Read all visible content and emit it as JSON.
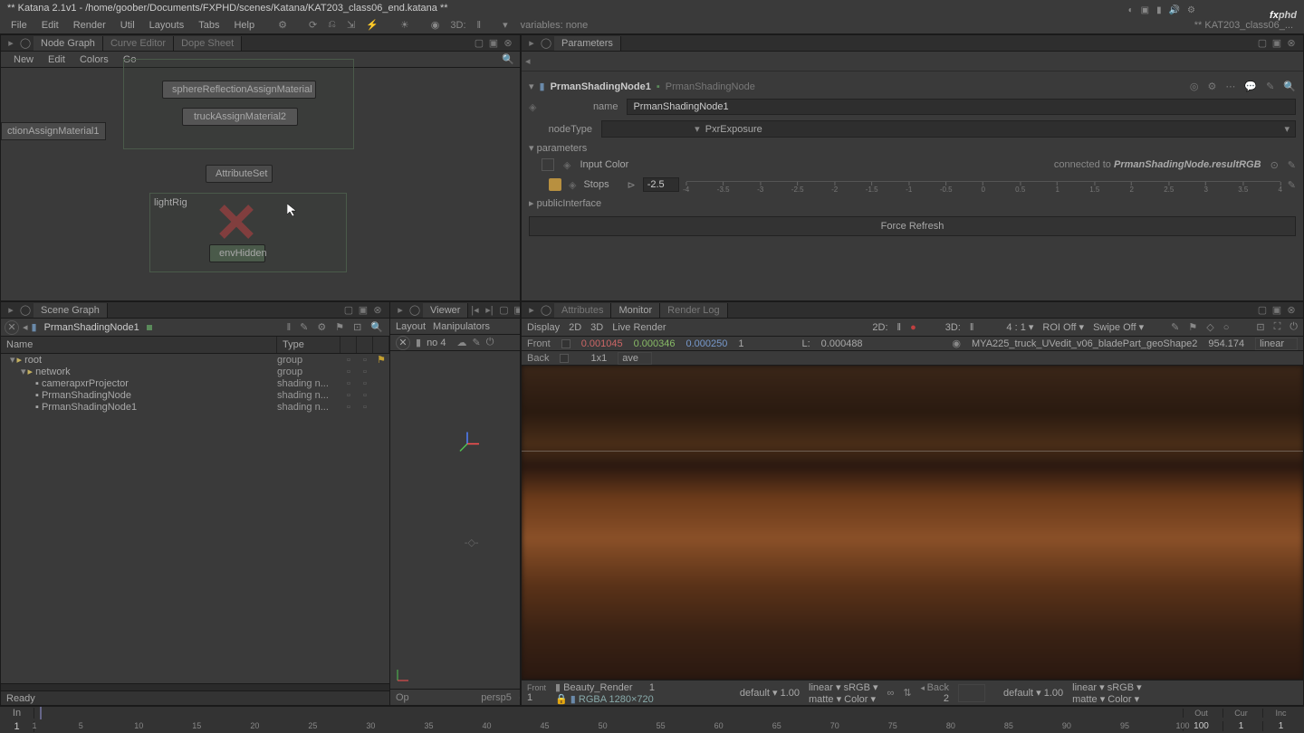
{
  "title": "** Katana 2.1v1 - /home/goober/Documents/FXPHD/scenes/Katana/KAT203_class06_end.katana **",
  "menubar": [
    "File",
    "Edit",
    "Render",
    "Util",
    "Layouts",
    "Tabs",
    "Help"
  ],
  "menubar_variables": "variables: none",
  "menubar_right_tab": "** KAT203_class06_...",
  "logo": {
    "fx": "fx",
    "phd": "phd"
  },
  "panels": {
    "nodegraph": {
      "tabs": [
        "Node Graph",
        "Curve Editor",
        "Dope Sheet"
      ],
      "toolbar": [
        "New",
        "Edit",
        "Colors",
        "Go"
      ],
      "nodes": {
        "sphere": "sphereReflectionAssignMaterial",
        "truck": "truckAssignMaterial2",
        "attr": "AttributeSet",
        "side": "ctionAssignMaterial1",
        "group_label": "lightRig",
        "env": "envHidden",
        "lightRig": "lightRig"
      }
    },
    "params": {
      "tab": "Parameters",
      "node_name": "PrmanShadingNode1",
      "node_type_label": "PrmanShadingNode",
      "rows": {
        "name_label": "name",
        "name_value": "PrmanShadingNode1",
        "nodetype_label": "nodeType",
        "nodetype_value": "PxrExposure",
        "section_params": "parameters",
        "input_color": "Input Color",
        "connected_prefix": "connected to ",
        "connected_value": "PrmanShadingNode.resultRGB",
        "stops_label": "Stops",
        "stops_value": "-2.5",
        "section_public": "publicInterface",
        "force_refresh": "Force Refresh",
        "ticks": [
          "-4",
          "-3.5",
          "-3",
          "-2.5",
          "-2",
          "-1.5",
          "-1",
          "-0.5",
          "0",
          "0.5",
          "1",
          "1.5",
          "2",
          "2.5",
          "3",
          "3.5",
          "4"
        ]
      }
    },
    "scenegraph": {
      "tab": "Scene Graph",
      "focus": "PrmanShadingNode1",
      "headers": {
        "name": "Name",
        "type": "Type"
      },
      "rows": [
        {
          "indent": 0,
          "exp": "-",
          "label": "root",
          "type": "group",
          "flag": true
        },
        {
          "indent": 1,
          "exp": "-",
          "label": "network",
          "type": "group"
        },
        {
          "indent": 2,
          "exp": "",
          "label": "camerapxrProjector",
          "type": "shading n..."
        },
        {
          "indent": 2,
          "exp": "",
          "label": "PrmanShadingNode",
          "type": "shading n..."
        },
        {
          "indent": 2,
          "exp": "",
          "label": "PrmanShadingNode1",
          "type": "shading n..."
        }
      ],
      "status": "Ready"
    },
    "viewer": {
      "tab": "Viewer",
      "toolbar": [
        "Layout",
        "Manipulators"
      ],
      "no_label": "no 4",
      "foot_left": "Op",
      "foot_right": "persp5"
    },
    "monitor": {
      "tabs": [
        "Attributes",
        "Monitor",
        "Render Log"
      ],
      "active_tab": 1,
      "toolbar": {
        "display": "Display",
        "d2": "2D",
        "d3": "3D",
        "live": "Live Render",
        "d2_right": "2D:",
        "d3_right": "3D:",
        "scale": "4 : 1 ▾",
        "roi": "ROI Off ▾",
        "swipe": "Swipe Off ▾"
      },
      "info": {
        "front": "Front",
        "r": "0.001045",
        "g": "0.000346",
        "b": "0.000250",
        "a": "1",
        "l_label": "L:",
        "l": "0.000488",
        "obj": "MYA225_truck_UVedit_v06_bladePart_geoShape2",
        "coord": "954.174",
        "mode": "linear"
      },
      "info2": {
        "back": "Back",
        "ratio": "1x1",
        "ave": "ave"
      },
      "foot": {
        "front": "Front",
        "front_n": "1",
        "name": "Beauty_Render",
        "one": "1",
        "default": "default ▾",
        "defval": "1.00",
        "linear": "linear ▾",
        "srgb": "sRGB ▾",
        "matte": "matte ▾",
        "color": "Color ▾",
        "rgba": "RGBA  1280×720",
        "back": "Back",
        "back_n": "2",
        "default2": "default ▾",
        "defval2": "1.00",
        "linear2": "linear ▾",
        "srgb2": "sRGB ▾",
        "matte2": "matte ▾",
        "color2": "Color ▾"
      }
    }
  },
  "timeline": {
    "in_label": "In",
    "out_label": "Out",
    "cur_label": "Cur",
    "inc_label": "Inc",
    "in": "1",
    "out": "100",
    "cur": "1",
    "inc": "1",
    "ticks": [
      1,
      5,
      10,
      15,
      20,
      25,
      30,
      35,
      40,
      45,
      50,
      55,
      60,
      65,
      70,
      75,
      80,
      85,
      90,
      95,
      100
    ]
  }
}
